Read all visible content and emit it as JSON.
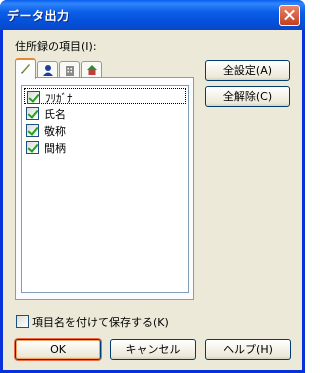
{
  "window": {
    "title": "データ出力"
  },
  "section_label": "住所録の項目(I):",
  "tabs": [
    {
      "icon": "pen-icon",
      "active": true
    },
    {
      "icon": "person-icon",
      "active": false
    },
    {
      "icon": "building-icon",
      "active": false
    },
    {
      "icon": "house-icon",
      "active": false
    }
  ],
  "items": [
    {
      "label": "ﾌﾘｶﾞﾅ",
      "checked": true
    },
    {
      "label": "氏名",
      "checked": true
    },
    {
      "label": "敬称",
      "checked": true
    },
    {
      "label": "間柄",
      "checked": true
    }
  ],
  "side_buttons": {
    "select_all": "全設定(A)",
    "clear_all": "全解除(C)"
  },
  "save_option": {
    "label": "項目名を付けて保存する(K)",
    "checked": false
  },
  "footer": {
    "ok": "OK",
    "cancel": "キャンセル",
    "help": "ヘルプ(H)"
  }
}
